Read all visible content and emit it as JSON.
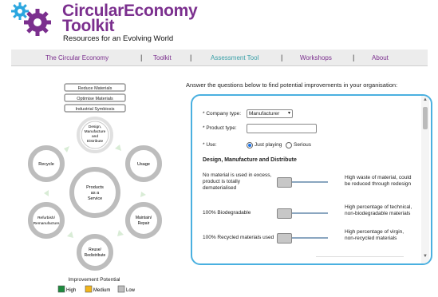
{
  "header": {
    "title_line1": "CircularEconomy",
    "title_line2": "Toolkit",
    "subtitle": "Resources for an Evolving World"
  },
  "nav": {
    "items": [
      "The Circular Economy",
      "Toolkit",
      "Assessment Tool",
      "Workshops",
      "About"
    ],
    "separator": "|",
    "active": "Assessment Tool"
  },
  "diagram": {
    "top_boxes": [
      "Reduce Materials",
      "Optimise Materials",
      "Industrial Symbiosis"
    ],
    "center": [
      "Products",
      "as a",
      "Service"
    ],
    "nodes": {
      "design": [
        "Design,",
        "Manufacture",
        "and",
        "Distribute"
      ],
      "usage": [
        "Usage"
      ],
      "maintain": [
        "Maintain/",
        "Repair"
      ],
      "reuse": [
        "Reuse/",
        "Redistribute"
      ],
      "refurbish": [
        "Refurbish/",
        "Remanufacture"
      ],
      "recycle": [
        "Recycle"
      ]
    },
    "legend_title": "Improvement Potential",
    "legend": [
      {
        "label": "High",
        "color": "#1e8a3e"
      },
      {
        "label": "Medium",
        "color": "#f2b51c"
      },
      {
        "label": "Low",
        "color": "#bdbdbd"
      }
    ]
  },
  "form": {
    "intro": "Answer the questions below to find potential improvements in your organisation:",
    "company_type_label": "* Company type:",
    "company_type_value": "Manufacturer",
    "product_type_label": "* Product type:",
    "product_type_value": "",
    "use_label": "* Use:",
    "use_options": [
      "Just playing",
      "Serious"
    ],
    "section_title": "Design, Manufacture and Distribute",
    "sliders": [
      {
        "left": [
          "No material is used in excess,",
          "product is totally",
          "dematerialised"
        ],
        "right": [
          "High waste of material, could",
          "be reduced through redesign"
        ],
        "value": 0
      },
      {
        "left": [
          "100% Biodegradable"
        ],
        "right": [
          "High percentage of technical,",
          "non-biodegradable materials"
        ],
        "value": 0
      },
      {
        "left": [
          "100% Recycled materials used"
        ],
        "right": [
          "High percentage of virgin,",
          "non-recycled materials"
        ],
        "value": 0
      }
    ]
  },
  "colors": {
    "brand_purple": "#7b2f8e",
    "gear_blue": "#2aa6df",
    "panel_border": "#4ab0e0",
    "nav_active": "#3aa0a8"
  }
}
